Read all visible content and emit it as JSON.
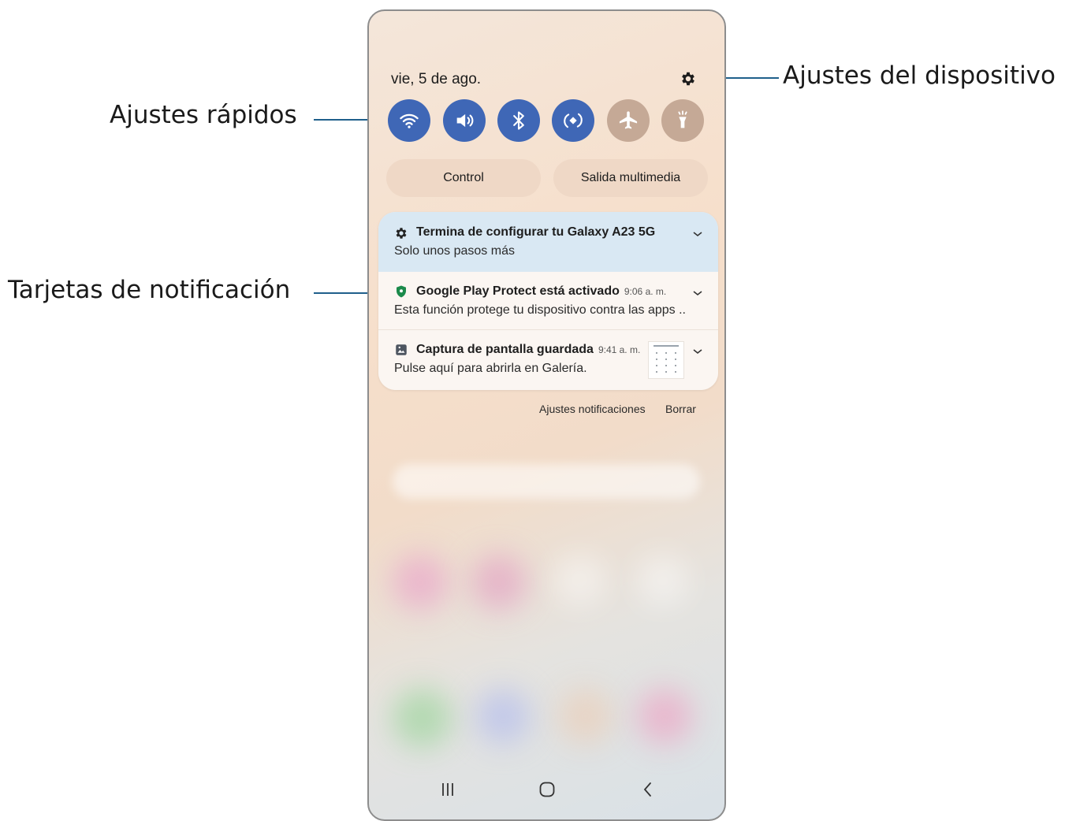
{
  "status": {
    "date": "vie, 5 de ago."
  },
  "quick_settings": {
    "tiles": [
      {
        "icon": "wifi-icon",
        "state": "on"
      },
      {
        "icon": "sound-icon",
        "state": "on"
      },
      {
        "icon": "bluetooth-icon",
        "state": "on"
      },
      {
        "icon": "auto-rotate-icon",
        "state": "on"
      },
      {
        "icon": "airplane-mode-icon",
        "state": "off"
      },
      {
        "icon": "flashlight-icon",
        "state": "off"
      }
    ],
    "on_color": "#3f67b6",
    "off_color": "#c5a996"
  },
  "media": {
    "control_label": "Control",
    "output_label": "Salida multimedia"
  },
  "notifications": [
    {
      "icon": "gear-icon",
      "title": "Termina de configurar tu Galaxy A23 5G",
      "time": "",
      "body": "Solo unos pasos más"
    },
    {
      "icon": "shield-icon",
      "title": "Google Play Protect está activado",
      "time": "9:06 a. m.",
      "body": "Esta función protege tu dispositivo contra las apps .."
    },
    {
      "icon": "image-icon",
      "title": "Captura de pantalla guardada",
      "time": "9:41 a. m.",
      "body": "Pulse aquí para abrirla en Galería."
    }
  ],
  "notification_footer": {
    "settings_label": "Ajustes notificaciones",
    "clear_label": "Borrar"
  },
  "callouts": {
    "quick_settings": "Ajustes rápidos",
    "device_settings": "Ajustes del dispositivo",
    "notification_cards": "Tarjetas de notificación"
  },
  "navigation": [
    "recents-icon",
    "home-icon",
    "back-icon"
  ]
}
